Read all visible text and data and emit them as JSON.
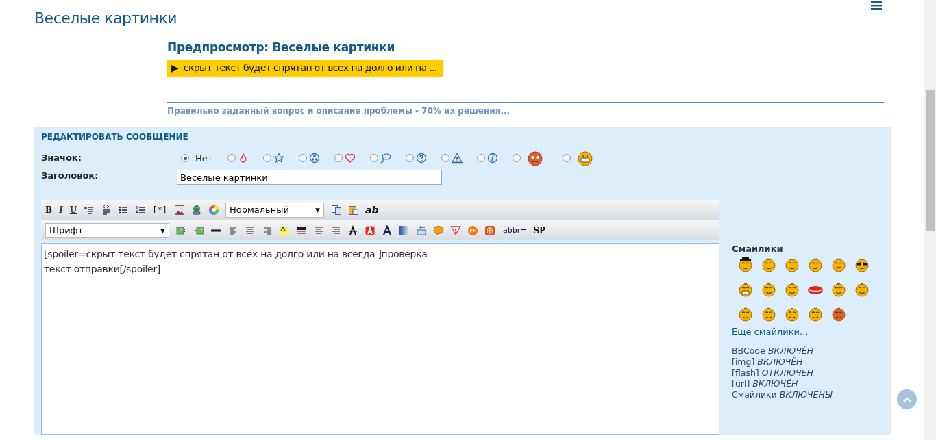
{
  "page_title": "Веселые картинки",
  "preview": {
    "title": "Предпросмотр: Веселые картинки",
    "spoiler": {
      "arrow": "▶",
      "text": "скрыт текст будет спрятан от всех на долго или на ...",
      "expanded": false
    },
    "signature": "Правильно заданный вопрос и описание проблемы - 70% их решения..."
  },
  "edit_panel": {
    "title": "РЕДАКТИРОВАТЬ СООБЩЕНИЕ",
    "icon_field": {
      "label": "Значок:",
      "options": [
        {
          "label": "Нет",
          "selected": true
        },
        {
          "selected": false
        },
        {
          "selected": false
        },
        {
          "selected": false
        },
        {
          "selected": false
        },
        {
          "selected": false
        },
        {
          "selected": false
        },
        {
          "selected": false
        },
        {
          "selected": false
        },
        {
          "selected": false
        },
        {
          "selected": false
        }
      ]
    },
    "subject_field": {
      "label": "Заголовок:",
      "value": "Веселые картинки"
    },
    "toolbar_rows": [
      [
        {
          "kind": "text",
          "label": "B"
        },
        {
          "kind": "text",
          "label": "I"
        },
        {
          "kind": "text",
          "label": "U"
        },
        {
          "kind": "icon"
        },
        {
          "kind": "icon"
        },
        {
          "kind": "icon"
        },
        {
          "kind": "icon"
        },
        {
          "kind": "text",
          "label": "[*]"
        },
        {
          "kind": "icon"
        },
        {
          "kind": "icon"
        },
        {
          "kind": "icon"
        },
        {
          "kind": "select",
          "value": "Нормальный",
          "arrow": "▼"
        },
        {
          "kind": "icon"
        },
        {
          "kind": "icon"
        },
        {
          "kind": "text",
          "label": "ab"
        }
      ],
      [
        {
          "kind": "select",
          "value": "Шрифт",
          "arrow": "▼"
        },
        {
          "kind": "icon"
        },
        {
          "kind": "icon"
        },
        {
          "kind": "icon"
        },
        {
          "kind": "icon"
        },
        {
          "kind": "icon"
        },
        {
          "kind": "icon"
        },
        {
          "kind": "icon"
        },
        {
          "kind": "icon"
        },
        {
          "kind": "icon"
        },
        {
          "kind": "icon"
        },
        {
          "kind": "icon"
        },
        {
          "kind": "icon"
        },
        {
          "kind": "icon"
        },
        {
          "kind": "icon"
        },
        {
          "kind": "icon"
        },
        {
          "kind": "icon"
        },
        {
          "kind": "icon"
        },
        {
          "kind": "icon"
        },
        {
          "kind": "icon"
        },
        {
          "kind": "text",
          "label": "abbr="
        },
        {
          "kind": "text",
          "label": "SP"
        }
      ]
    ],
    "message_text": "[spoiler=скрыт текст будет спрятан от всех на долго или на всегда ]проверка\nтекст отправки[/spoiler]",
    "smilies": {
      "title": "Смайлики",
      "more_link": "Ещё смайлики..."
    },
    "status": [
      {
        "label": "BBCode",
        "value": "ВКЛЮЧЁН"
      },
      {
        "label": "[img]",
        "value": "ВКЛЮЧЁН"
      },
      {
        "label": "[flash]",
        "value": "ОТКЛЮЧЕН"
      },
      {
        "label": "[url]",
        "value": "ВКЛЮЧЁН"
      },
      {
        "label": "Смайлики",
        "value": "ВКЛЮЧЕНЫ"
      }
    ]
  }
}
